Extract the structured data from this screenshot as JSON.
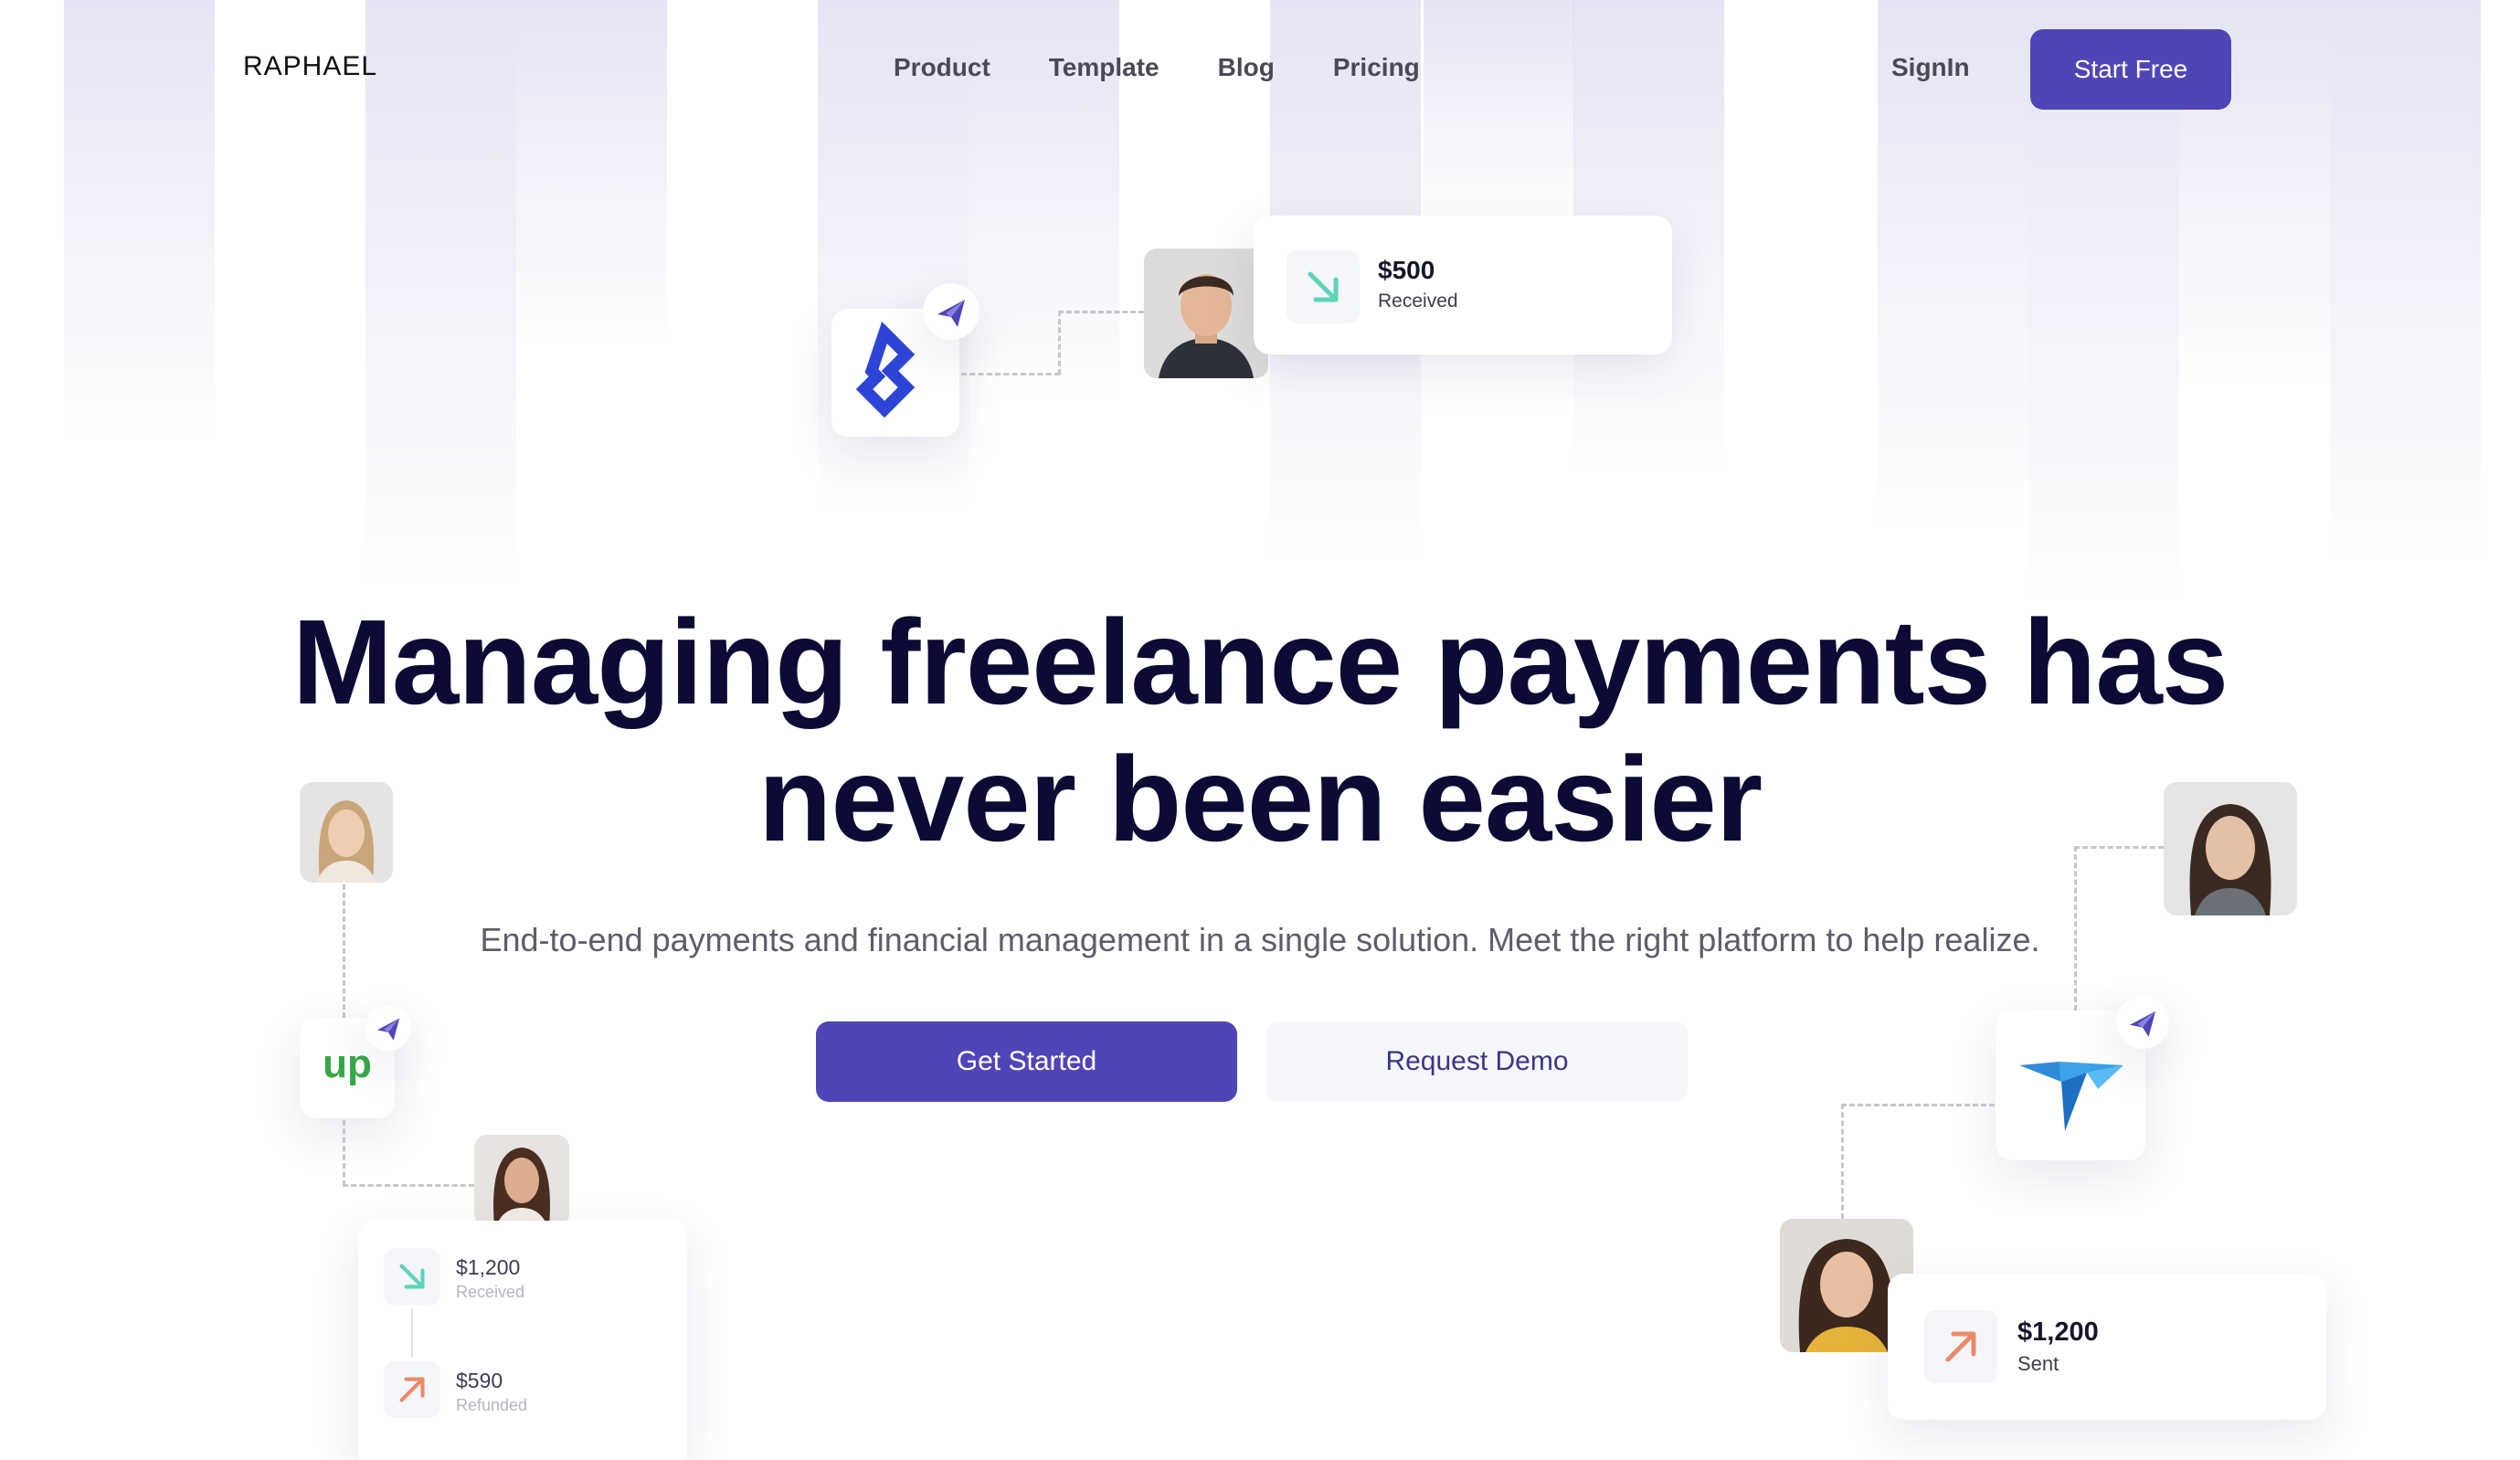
{
  "brand": {
    "logo": "RAPHAEL"
  },
  "nav": {
    "items": [
      {
        "label": "Product"
      },
      {
        "label": "Template"
      },
      {
        "label": "Blog"
      },
      {
        "label": "Pricing"
      }
    ],
    "signin": "SignIn",
    "start_free": "Start Free"
  },
  "hero": {
    "headline_line1": "Managing freelance payments has",
    "headline_line2": "never been easier",
    "subtitle": "End-to-end payments and financial management in a single solution. Meet the right platform to help realize.",
    "primary_cta": "Get Started",
    "secondary_cta": "Request Demo"
  },
  "cards": {
    "top": {
      "amount": "$500",
      "label": "Received"
    },
    "left_received": {
      "amount": "$1,200",
      "label": "Received"
    },
    "left_refunded": {
      "amount": "$590",
      "label": "Refunded"
    },
    "right_sent": {
      "amount": "$1,200",
      "label": "Sent"
    }
  },
  "colors": {
    "accent": "#4f45b6",
    "headline": "#0b0b35",
    "received_arrow": "#5fd3b8",
    "sent_arrow": "#ec8a68",
    "toptal_blue": "#2c45d6",
    "upwork_green": "#37a84a",
    "payoneer_blue": "#3aa3ea"
  },
  "icons": {
    "plane": "paper-plane-icon",
    "received": "arrow-down-right-icon",
    "sent": "arrow-up-right-icon",
    "toptal": "toptal-logo",
    "upwork": "upwork-logo",
    "bird": "bird-logo"
  }
}
